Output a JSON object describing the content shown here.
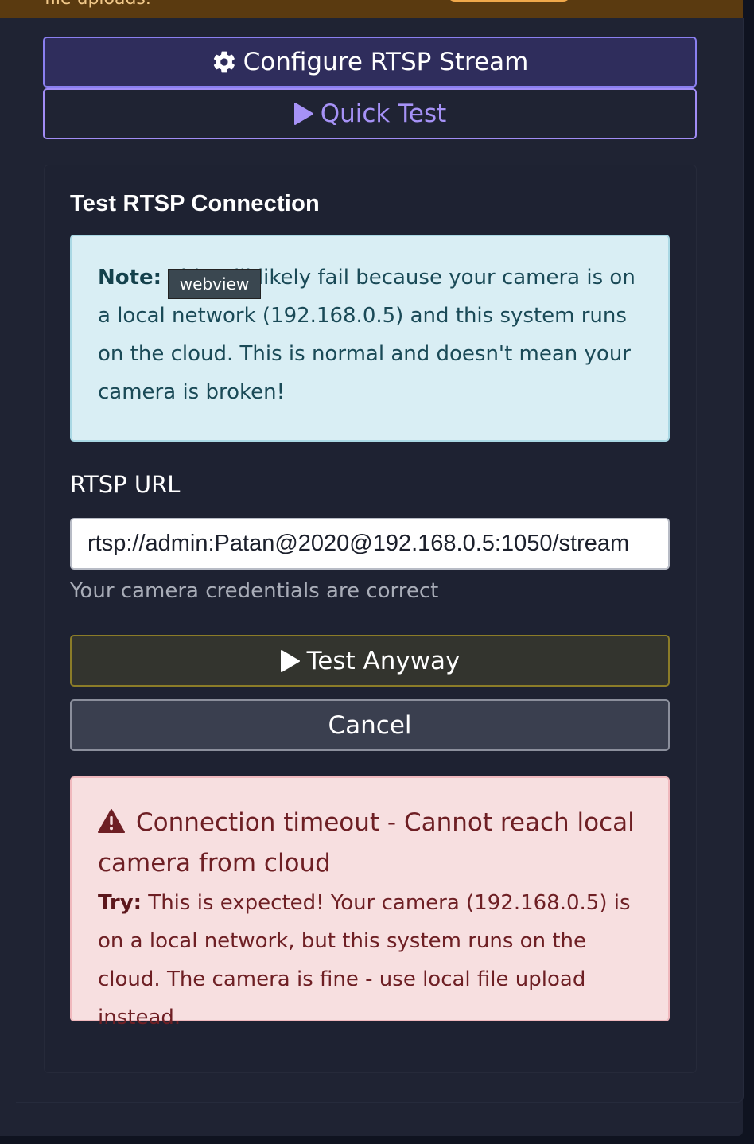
{
  "banner": {
    "text": "file uploads.",
    "colors": {
      "background": "#5a3a10",
      "text": "#f2c98a",
      "pill": "#f0a84a"
    }
  },
  "buttons": {
    "configure": {
      "label": "Configure RTSP Stream",
      "icon": "gear-icon"
    },
    "quick_test": {
      "label": "Quick Test",
      "icon": "play-icon"
    },
    "test_anyway": {
      "label": "Test Anyway",
      "icon": "play-icon"
    },
    "cancel": {
      "label": "Cancel"
    }
  },
  "tooltip": {
    "text": "webview"
  },
  "card": {
    "title": "Test RTSP Connection",
    "note": {
      "label": "Note:",
      "text": " This will likely fail because your camera is on a local network (192.168.0.5) and this system runs on the cloud. This is normal and doesn't mean your camera is broken!"
    },
    "url_field": {
      "label": "RTSP URL",
      "value": "rtsp://admin:Patan@2020@192.168.0.5:1050/stream",
      "help": "Your camera credentials are correct"
    },
    "error": {
      "icon": "warning-triangle-icon",
      "title": "Connection timeout - Cannot reach local camera from cloud",
      "try_label": "Try:",
      "try_text": " This is expected! Your camera (192.168.0.5) is on a local network, but this system runs on the cloud. The camera is fine - use local file upload instead."
    }
  },
  "colors": {
    "page_bg": "#1f2333",
    "accent": "#8a7ff0",
    "info_bg": "#d9eef4",
    "error_bg": "#f7dfe0",
    "warning_border": "#8b7c28"
  }
}
